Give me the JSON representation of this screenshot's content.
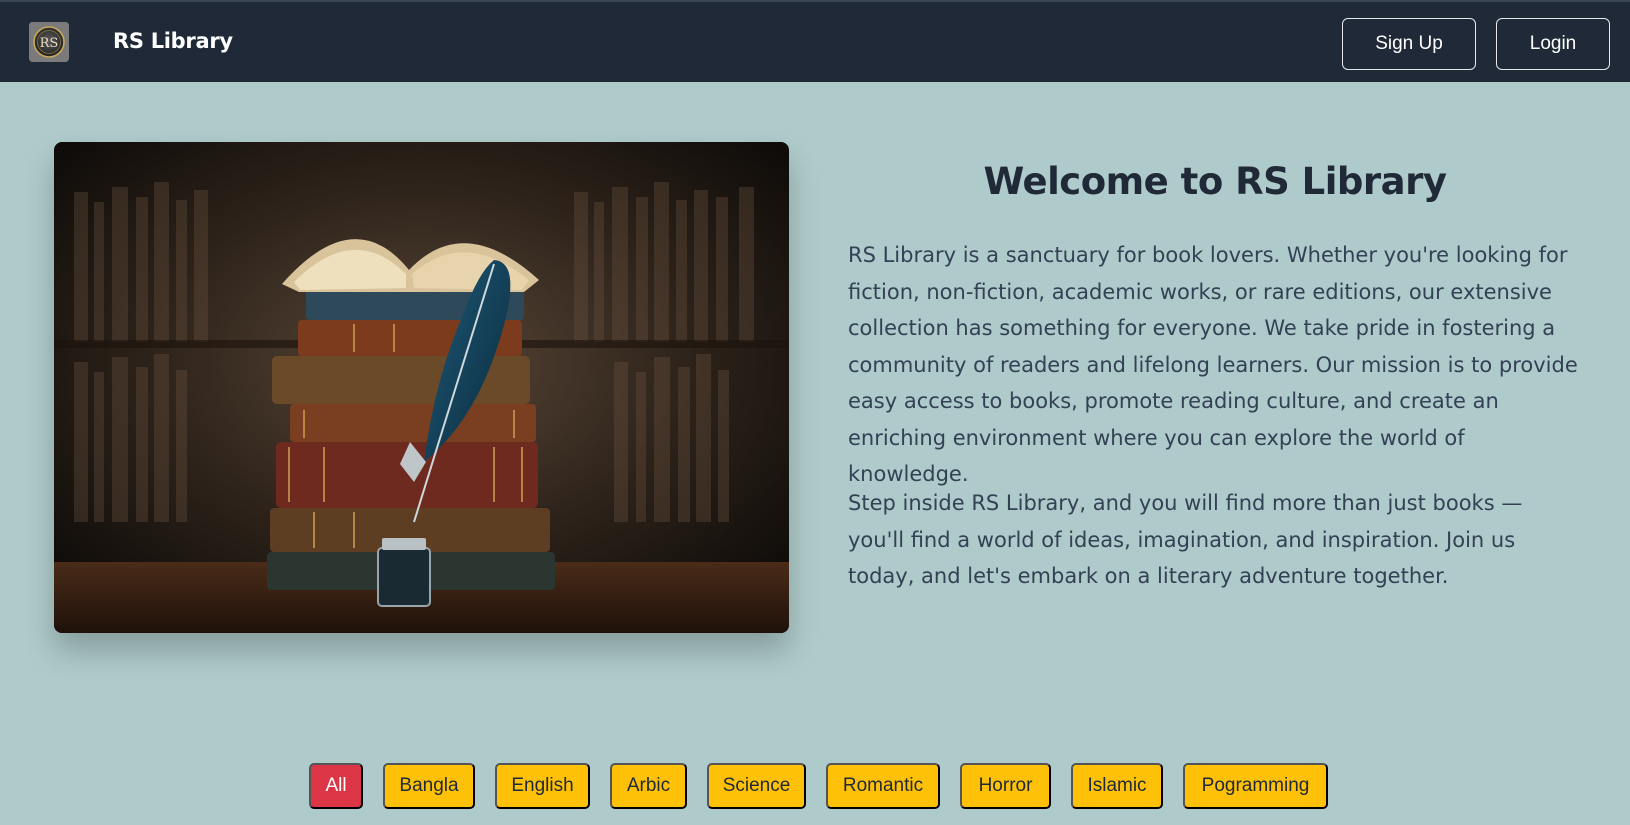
{
  "navbar": {
    "logo_text": "RS",
    "brand": "RS Library",
    "signup_label": "Sign Up",
    "login_label": "Login"
  },
  "hero": {
    "title": "Welcome to RS Library",
    "paragraphs": [
      "RS Library is a sanctuary for book lovers. Whether you're looking for fiction, non-fiction, academic works, or rare editions, our extensive collection has something for everyone. We take pride in fostering a community of readers and lifelong learners. Our mission is to provide easy access to books, promote reading culture, and create an enriching environment where you can explore the world of knowledge.",
      "Step inside RS Library, and you will find more than just books — you'll find a world of ideas, imagination, and inspiration. Join us today, and let's embark on a literary adventure together."
    ]
  },
  "categories": {
    "active": "All",
    "items": [
      "All",
      "Bangla",
      "English",
      "Arbic",
      "Science",
      "Romantic",
      "Horror",
      "Islamic",
      "Pogramming"
    ]
  },
  "colors": {
    "navbar_bg": "#1f2937",
    "page_bg": "#aecaca",
    "active_tab": "#dc3545",
    "tab": "#ffc107"
  }
}
